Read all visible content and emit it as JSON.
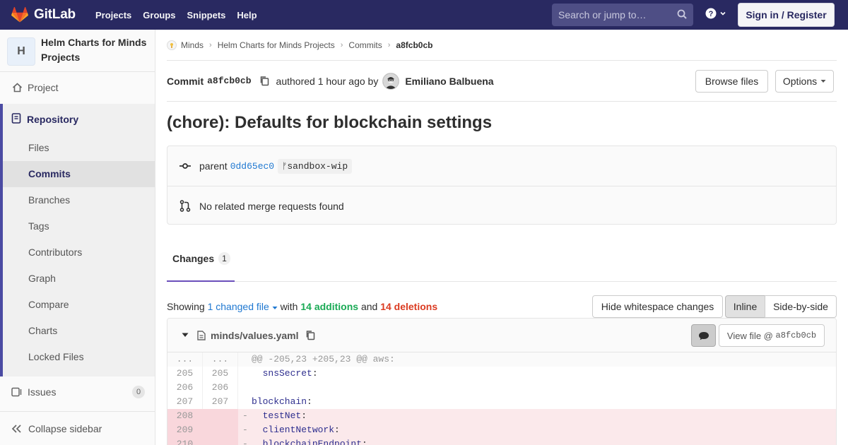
{
  "navbar": {
    "brand": "GitLab",
    "links": [
      "Projects",
      "Groups",
      "Snippets",
      "Help"
    ],
    "search_placeholder": "Search or jump to…",
    "sign_in": "Sign in / Register",
    "help_icon": "question-circle-icon"
  },
  "sidebar": {
    "project_initial": "H",
    "project_name": "Helm Charts for Minds Projects",
    "project_label": "Project",
    "repository_label": "Repository",
    "repo_items": [
      "Files",
      "Commits",
      "Branches",
      "Tags",
      "Contributors",
      "Graph",
      "Compare",
      "Charts",
      "Locked Files"
    ],
    "active_item": "Commits",
    "issues_label": "Issues",
    "issues_count": "0",
    "collapse_label": "Collapse sidebar"
  },
  "breadcrumb": {
    "group": "Minds",
    "project": "Helm Charts for Minds Projects",
    "section": "Commits",
    "current": "a8fcb0cb"
  },
  "commit": {
    "label": "Commit",
    "sha": "a8fcb0cb",
    "authored": "authored 1 hour ago by",
    "author": "Emiliano Balbuena",
    "browse_files": "Browse files",
    "options": "Options",
    "title": "(chore): Defaults for blockchain settings",
    "parent_label": "parent",
    "parent_sha": "0dd65ec0",
    "branch": "sandbox-wip",
    "merge_requests": "No related merge requests found"
  },
  "changes": {
    "tab_label": "Changes",
    "tab_count": "1",
    "showing": "Showing",
    "changed_files": "1 changed file",
    "with": "with",
    "additions": "14 additions",
    "and": "and",
    "deletions": "14 deletions",
    "hide_whitespace": "Hide whitespace changes",
    "inline": "Inline",
    "side_by_side": "Side-by-side"
  },
  "file": {
    "path": "minds/values.yaml",
    "view_file": "View file @",
    "view_sha": "a8fcb0cb",
    "diff_header": "@@ -205,23 +205,23 @@ aws:",
    "rows": [
      {
        "type": "meta",
        "old": "...",
        "new": "...",
        "sign": "",
        "key": "",
        "rest": ""
      },
      {
        "type": "ctx",
        "old": "205",
        "new": "205",
        "sign": " ",
        "key": "  snsSecret",
        "rest": ":"
      },
      {
        "type": "ctx",
        "old": "206",
        "new": "206",
        "sign": " ",
        "key": "",
        "rest": ""
      },
      {
        "type": "ctx",
        "old": "207",
        "new": "207",
        "sign": " ",
        "key": "blockchain",
        "rest": ":"
      },
      {
        "type": "del",
        "old": "208",
        "new": "",
        "sign": "-",
        "key": "  testNet",
        "rest": ":"
      },
      {
        "type": "del",
        "old": "209",
        "new": "",
        "sign": "-",
        "key": "  clientNetwork",
        "rest": ":"
      },
      {
        "type": "del",
        "old": "210",
        "new": "",
        "sign": "-",
        "key": "  blockchainEndpoint",
        "rest": ":"
      }
    ]
  }
}
